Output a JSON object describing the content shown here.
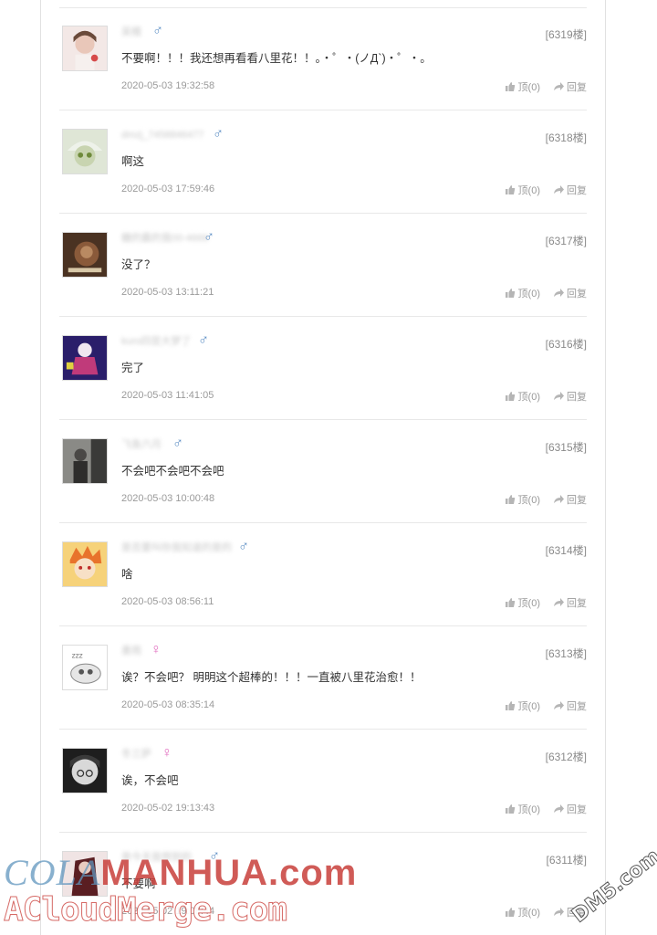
{
  "actions": {
    "like": "顶(0)",
    "reply": "回复"
  },
  "comments": [
    {
      "user": "吴檀",
      "gender": "♂",
      "floor": "[6319楼]",
      "text": "不要啊！！！我还想再看看八里花！！。・゜・(ノД`)・゜・。",
      "time": "2020-05-03 19:32:58"
    },
    {
      "user": "dmzj_7458846477",
      "gender": "♂",
      "floor": "[6318楼]",
      "text": "啊这",
      "time": "2020-05-03 17:59:46"
    },
    {
      "user": "糖的霸的我00-4666",
      "gender": "♂",
      "floor": "[6317楼]",
      "text": "没了？",
      "time": "2020-05-03 13:11:21"
    },
    {
      "user": "kuro四宫大梦了",
      "gender": "♂",
      "floor": "[6316楼]",
      "text": "完了",
      "time": "2020-05-03 11:41:05"
    },
    {
      "user": "飞鱼六月",
      "gender": "♂",
      "floor": "[6315楼]",
      "text": "不会吧不会吧不会吧",
      "time": "2020-05-03 10:00:48"
    },
    {
      "user": "是否要叫你我知道的是的",
      "gender": "♂",
      "floor": "[6314楼]",
      "text": "啥",
      "time": "2020-05-03 08:56:11"
    },
    {
      "user": "墨雨",
      "gender": "♀",
      "floor": "[6313楼]",
      "text": "诶？不会吧？ 明明这个超棒的！！！一直被八里花治愈！！",
      "time": "2020-05-03 08:35:14"
    },
    {
      "user": "冬三萨",
      "gender": "♀",
      "floor": "[6312楼]",
      "text": "诶，不会吧",
      "time": "2020-05-02 19:13:43"
    },
    {
      "user": "是今天我想到的",
      "gender": "♂",
      "floor": "[6311楼]",
      "text": "不要啊",
      "time": "2020-05-02 19:08:44"
    }
  ],
  "watermark": {
    "part1": "COLA",
    "part2": "MANHUA.com",
    "line2": "ACloudMerge.com",
    "badge": "DM5.com"
  },
  "colors": {
    "male": "#5b8dc4",
    "female": "#e26fc0"
  }
}
